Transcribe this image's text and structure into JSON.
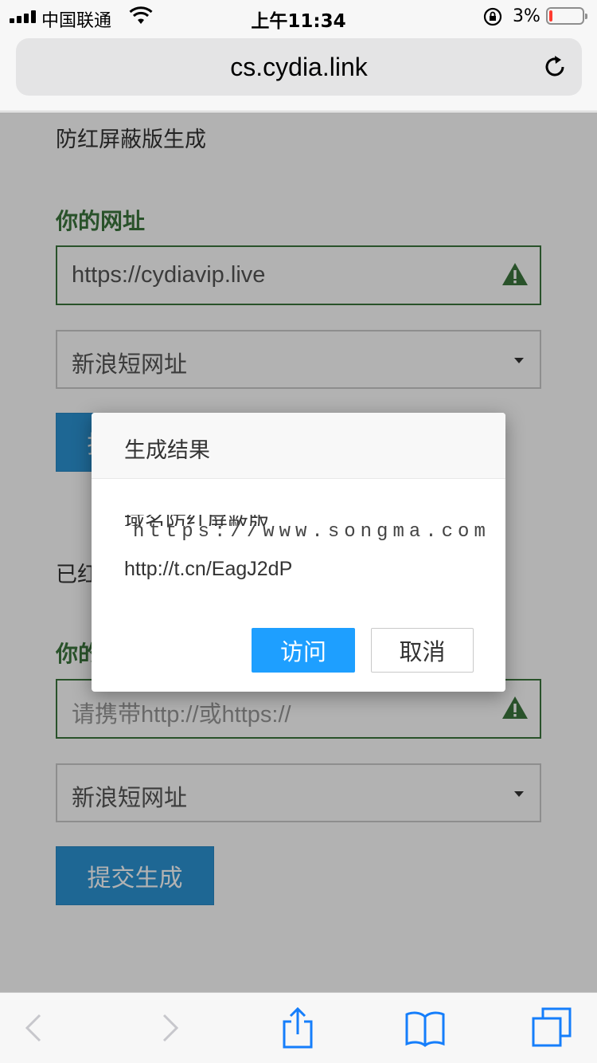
{
  "status_bar": {
    "carrier": "中国联通",
    "time": "上午11:34",
    "battery_percent": "3%",
    "battery_level": 0.03,
    "battery_color": "#ff3b30"
  },
  "browser": {
    "url": "cs.cydia.link",
    "reload_icon": "reload-icon",
    "toolbar_icons": [
      "back-icon",
      "forward-icon",
      "share-icon",
      "bookmarks-icon",
      "tabs-icon"
    ]
  },
  "page": {
    "section1_title": "防红屏蔽版生成",
    "form1": {
      "label": "你的网址",
      "input_value": "https://cydiavip.live",
      "select_value": "新浪短网址",
      "submit_label": "提交生成"
    },
    "section2_title": "已红",
    "form2": {
      "label": "你的",
      "input_placeholder": "请携带http://或https://",
      "select_value": "新浪短网址",
      "submit_label": "提交生成"
    },
    "accent_green": "#3c763d",
    "accent_blue": "#2c94d4"
  },
  "modal": {
    "title": "生成结果",
    "line1": "域名防红屏蔽版",
    "result_url": "http://t.cn/EagJ2dP",
    "watermark": "https://www.songma.com",
    "visit_label": "访问",
    "cancel_label": "取消",
    "visit_color": "#1e9fff"
  }
}
